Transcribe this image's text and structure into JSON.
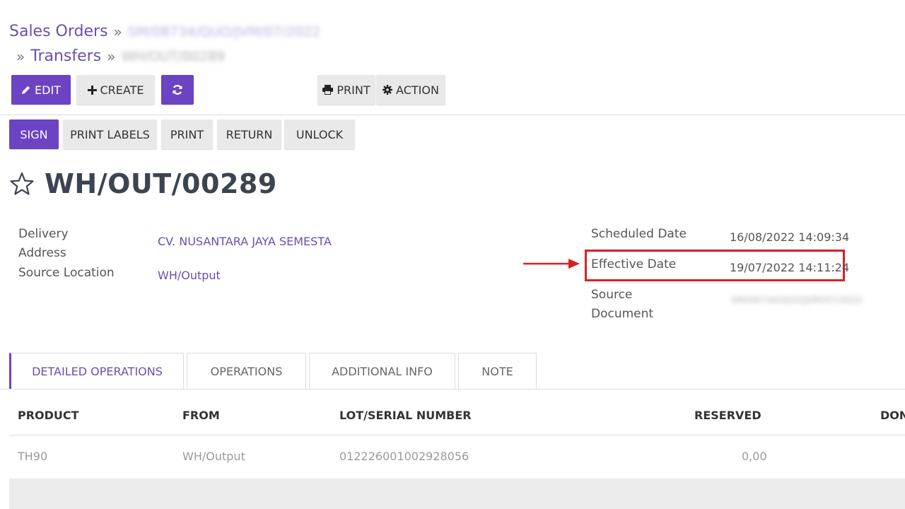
{
  "breadcrumb": {
    "sales_orders": "Sales Orders",
    "order_ref": "SM/08734/QUO/JVM/07/2022",
    "transfers": "Transfers",
    "current_ref": "WH/OUT/00289",
    "separator": "»"
  },
  "toolbar": {
    "edit_label": "EDIT",
    "create_label": "CREATE",
    "print_label": "PRINT",
    "action_label": "ACTION"
  },
  "status_bar": {
    "sign_label": "SIGN",
    "print_labels_label": "PRINT LABELS",
    "print_label": "PRINT",
    "return_label": "RETURN",
    "unlock_label": "UNLOCK"
  },
  "record": {
    "title": "WH/OUT/00289"
  },
  "fields": {
    "delivery_address_label": "Delivery Address",
    "delivery_address_value": "CV. NUSANTARA JAYA SEMESTA",
    "source_location_label": "Source Location",
    "source_location_value": "WH/Output",
    "scheduled_date_label": "Scheduled Date",
    "scheduled_date_value": "16/08/2022 14:09:34",
    "effective_date_label": "Effective Date",
    "effective_date_value": "19/07/2022 14:11:24",
    "source_document_label": "Source Document",
    "source_document_value": "SM/08734/QUO/JVM/07/2022"
  },
  "tabs": [
    {
      "label": "DETAILED OPERATIONS"
    },
    {
      "label": "OPERATIONS"
    },
    {
      "label": "ADDITIONAL INFO"
    },
    {
      "label": "NOTE"
    }
  ],
  "table": {
    "headers": [
      "PRODUCT",
      "FROM",
      "LOT/SERIAL NUMBER",
      "RESERVED",
      "DON"
    ],
    "rows": [
      [
        "TH90",
        "WH/Output",
        "012226001002928056",
        "0,00"
      ]
    ]
  },
  "colors": {
    "primary": "#6c43c2",
    "link": "#6b4fae",
    "highlight": "#d92020"
  }
}
